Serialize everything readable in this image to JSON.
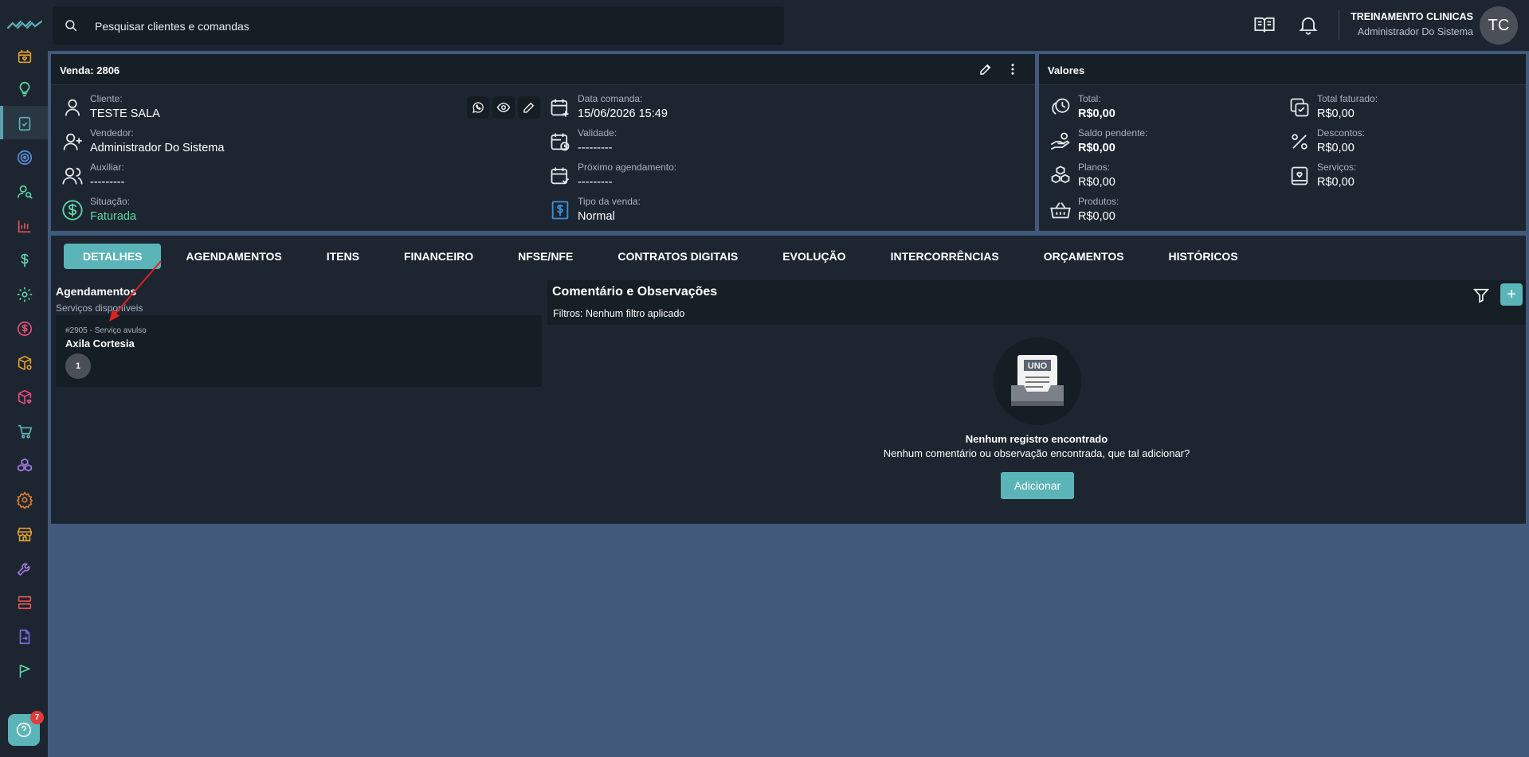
{
  "search": {
    "placeholder": "Pesquisar clientes e comandas"
  },
  "user": {
    "name": "TREINAMENTO CLINICAS",
    "role": "Administrador Do Sistema",
    "initials": "TC"
  },
  "notifications": {
    "help_badge": "7"
  },
  "sidebar_icons": [
    "calendar-heart-icon",
    "lightbulb-icon",
    "clipboard-check-icon",
    "target-icon",
    "user-search-icon",
    "bar-chart-icon",
    "dollar-icon",
    "cog-icon",
    "money-circle-icon",
    "box-cog-icon",
    "box-heart-icon",
    "cart-icon",
    "cubes-icon",
    "settings-icon",
    "store-icon",
    "wrench-icon",
    "server-icon",
    "file-export-icon",
    "flag-icon"
  ],
  "venda": {
    "title": "Venda: 2806",
    "left_fields": [
      {
        "label": "Cliente:",
        "value": "TESTE SALA"
      },
      {
        "label": "Vendedor:",
        "value": "Administrador Do Sistema"
      },
      {
        "label": "Auxiliar:",
        "value": "---------"
      },
      {
        "label": "Situação:",
        "value": "Faturada"
      }
    ],
    "right_fields": [
      {
        "label": "Data comanda:",
        "value": "15/06/2026 15:49"
      },
      {
        "label": "Validade:",
        "value": "---------"
      },
      {
        "label": "Próximo agendamento:",
        "value": "---------"
      },
      {
        "label": "Tipo da venda:",
        "value": "Normal"
      }
    ]
  },
  "valores": {
    "title": "Valores",
    "left": [
      {
        "label": "Total:",
        "value": "R$0,00"
      },
      {
        "label": "Saldo pendente:",
        "value": "R$0,00"
      },
      {
        "label": "Planos:",
        "value": "R$0,00"
      },
      {
        "label": "Produtos:",
        "value": "R$0,00"
      }
    ],
    "right": [
      {
        "label": "Total faturado:",
        "value": "R$0,00"
      },
      {
        "label": "Descontos:",
        "value": "R$0,00"
      },
      {
        "label": "Serviços:",
        "value": "R$0,00"
      }
    ]
  },
  "tabs": [
    "DETALHES",
    "AGENDAMENTOS",
    "ITENS",
    "FINANCEIRO",
    "NFSE/NFE",
    "CONTRATOS DIGITAIS",
    "EVOLUÇÃO",
    "INTERCORRÊNCIAS",
    "ORÇAMENTOS",
    "HISTÓRICOS"
  ],
  "agendamentos": {
    "title": "Agendamentos",
    "subtitle": "Serviços disponíveis",
    "item": {
      "meta": "#2905 - Serviço avulso",
      "name": "Axila Cortesia",
      "qty": "1"
    }
  },
  "comentarios": {
    "title": "Comentário e Observações",
    "filters": "Filtros:  Nenhum filtro aplicado",
    "art_text": "UNO",
    "empty_title": "Nenhum registro encontrado",
    "empty_sub": "Nenhum comentário ou observação encontrada, que tal adicionar?",
    "add_label": "Adicionar"
  },
  "colors": {
    "accent": "#5bb4b8",
    "success": "#5fd3a6",
    "badge": "#e23b3b",
    "annotation": "#e02020"
  }
}
